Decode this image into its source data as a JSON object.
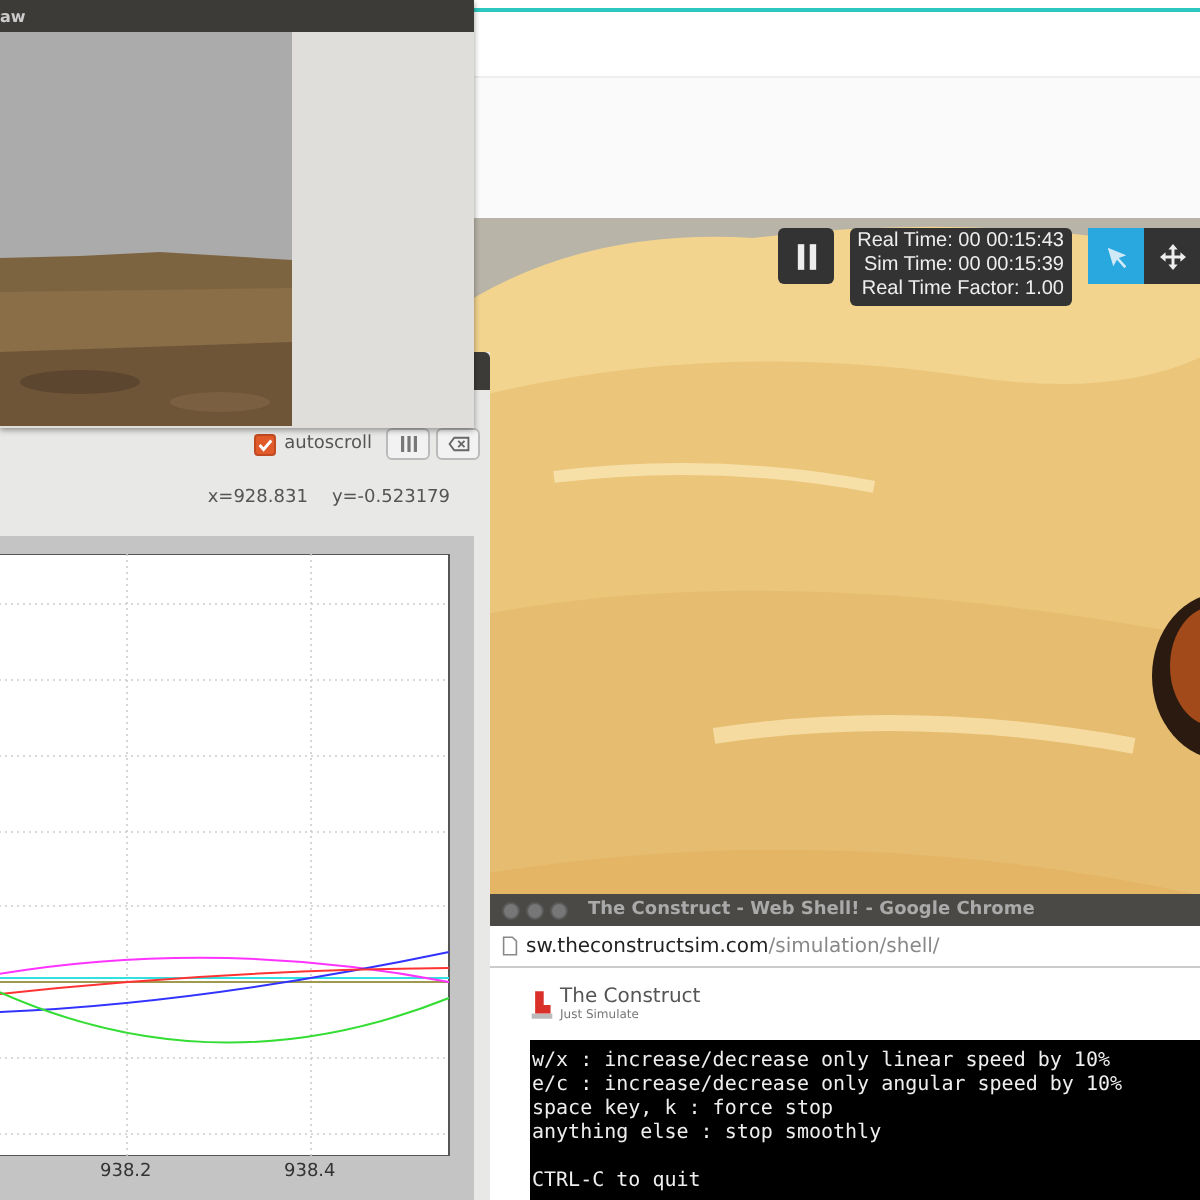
{
  "image_view": {
    "title": "aw"
  },
  "plot_window": {
    "autoscroll": {
      "label": "autoscroll",
      "checked": true
    },
    "cursor": {
      "x": "x=928.831",
      "y": "y=-0.523179"
    },
    "x_ticks": [
      "938.2",
      "938.4"
    ]
  },
  "simulation": {
    "time_panel": [
      "Real Time: 00 00:15:43",
      "Sim Time: 00 00:15:39",
      "Real Time Factor: 1.00"
    ],
    "tools": [
      {
        "kind": "select",
        "selected": true
      },
      {
        "kind": "translate",
        "selected": false
      }
    ]
  },
  "shell_window": {
    "title": "The Construct - Web Shell! - Google Chrome",
    "url": {
      "domain": "sw.theconstructsim.com",
      "path": "/simulation/shell/"
    },
    "brand": {
      "name": "The Construct",
      "tagline": "Just Simulate"
    },
    "terminal_blocks": [
      {
        "lines": [
          "w/x : increase/decrease only linear speed by 10%",
          "e/c : increase/decrease only angular speed by 10%",
          "space key, k : force stop",
          "anything else : stop smoothly"
        ]
      },
      {
        "lines": [
          "CTRL-C to quit"
        ]
      }
    ]
  }
}
